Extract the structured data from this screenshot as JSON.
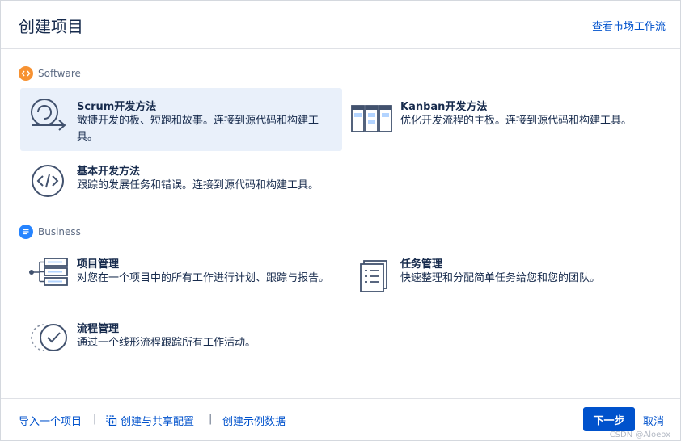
{
  "header": {
    "title": "创建项目",
    "market_link": "查看市场工作流"
  },
  "sections": {
    "software": {
      "label": "Software",
      "color": "#f79232"
    },
    "business": {
      "label": "Business",
      "color": "#2684ff"
    }
  },
  "options": {
    "scrum": {
      "title": "Scrum开发方法",
      "desc": "敏捷开发的板、短跑和故事。连接到源代码和构建工具。",
      "selected": true
    },
    "kanban": {
      "title": "Kanban开发方法",
      "desc": "优化开发流程的主板。连接到源代码和构建工具。"
    },
    "basic": {
      "title": "基本开发方法",
      "desc": "跟踪的发展任务和错误。连接到源代码和构建工具。"
    },
    "project": {
      "title": "项目管理",
      "desc": "对您在一个项目中的所有工作进行计划、跟踪与报告。"
    },
    "task": {
      "title": "任务管理",
      "desc": "快速整理和分配简单任务给您和您的团队。"
    },
    "process": {
      "title": "流程管理",
      "desc": "通过一个线形流程跟踪所有工作活动。"
    }
  },
  "footer": {
    "import_link": "导入一个项目",
    "shared_config_link": "创建与共享配置",
    "sample_data_link": "创建示例数据",
    "next_button": "下一步",
    "cancel_button": "取消",
    "watermark": "CSDN @Aloeox"
  },
  "colors": {
    "accent": "#0052cc",
    "selected_bg": "#e9f0fa",
    "icon_stroke": "#42526e"
  }
}
